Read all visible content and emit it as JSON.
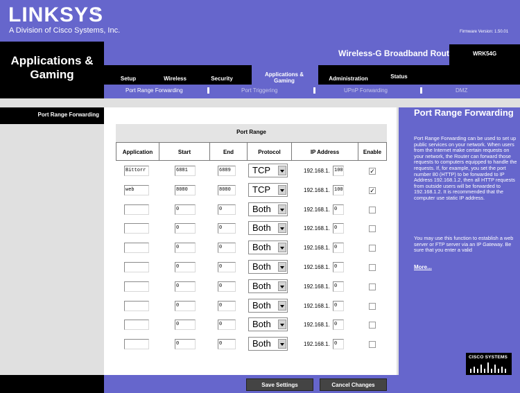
{
  "header": {
    "brand": "LINKSYS",
    "brand_reg": "®",
    "tagline": "A Division of Cisco Systems, Inc.",
    "firmware": "Firmware Version: 1.50.01"
  },
  "section": {
    "title": "Applications & Gaming"
  },
  "product": {
    "name": "Wireless-G Broadband Router",
    "model": "WRK54G"
  },
  "tabs": [
    {
      "label": "Setup"
    },
    {
      "label": "Wireless"
    },
    {
      "label": "Security"
    },
    {
      "label": "Applications & Gaming"
    },
    {
      "label": "Administration"
    },
    {
      "label": "Status"
    }
  ],
  "subtabs": [
    {
      "label": "Port Range Forwarding"
    },
    {
      "label": "Port Triggering"
    },
    {
      "label": "UPnP Forwarding"
    },
    {
      "label": "DMZ"
    }
  ],
  "left_nav": {
    "label": "Port Range Forwarding"
  },
  "table": {
    "title": "Port Range",
    "headers": [
      "Application",
      "Start",
      "End",
      "Protocol",
      "IP Address",
      "Enable"
    ],
    "ip_prefix": "192.168.1.",
    "rows": [
      {
        "app": "Bittorr",
        "start": "6881",
        "end": "6889",
        "protocol": "TCP",
        "ip_last": "100",
        "enabled": true
      },
      {
        "app": "web",
        "start": "8080",
        "end": "8080",
        "protocol": "TCP",
        "ip_last": "100",
        "enabled": true
      },
      {
        "app": "",
        "start": "0",
        "end": "0",
        "protocol": "Both",
        "ip_last": "0",
        "enabled": false
      },
      {
        "app": "",
        "start": "0",
        "end": "0",
        "protocol": "Both",
        "ip_last": "0",
        "enabled": false
      },
      {
        "app": "",
        "start": "0",
        "end": "0",
        "protocol": "Both",
        "ip_last": "0",
        "enabled": false
      },
      {
        "app": "",
        "start": "0",
        "end": "0",
        "protocol": "Both",
        "ip_last": "0",
        "enabled": false
      },
      {
        "app": "",
        "start": "0",
        "end": "0",
        "protocol": "Both",
        "ip_last": "0",
        "enabled": false
      },
      {
        "app": "",
        "start": "0",
        "end": "0",
        "protocol": "Both",
        "ip_last": "0",
        "enabled": false
      },
      {
        "app": "",
        "start": "0",
        "end": "0",
        "protocol": "Both",
        "ip_last": "0",
        "enabled": false
      },
      {
        "app": "",
        "start": "0",
        "end": "0",
        "protocol": "Both",
        "ip_last": "0",
        "enabled": false
      }
    ]
  },
  "help": {
    "title": "Port Range Forwarding",
    "text1": "Port Range Forwarding can be used to set up public services on your network. When users from the Internet make certain requests on your network, the Router can forward those requests to computers equipped to handle the requests. If, for example, you set the port number 80 (HTTP) to be forwarded to IP Address 192.168.1.2, then all HTTP requests from outside users will be forwarded to 192.168.1.2. It is recommended that the computer use static IP address.",
    "text2": "You may use this function to establish a web server or FTP server via an IP Gateway. Be sure that you enter a valid",
    "more": "More..."
  },
  "cisco": {
    "label": "CISCO SYSTEMS"
  },
  "buttons": {
    "save": "Save Settings",
    "cancel": "Cancel Changes"
  }
}
